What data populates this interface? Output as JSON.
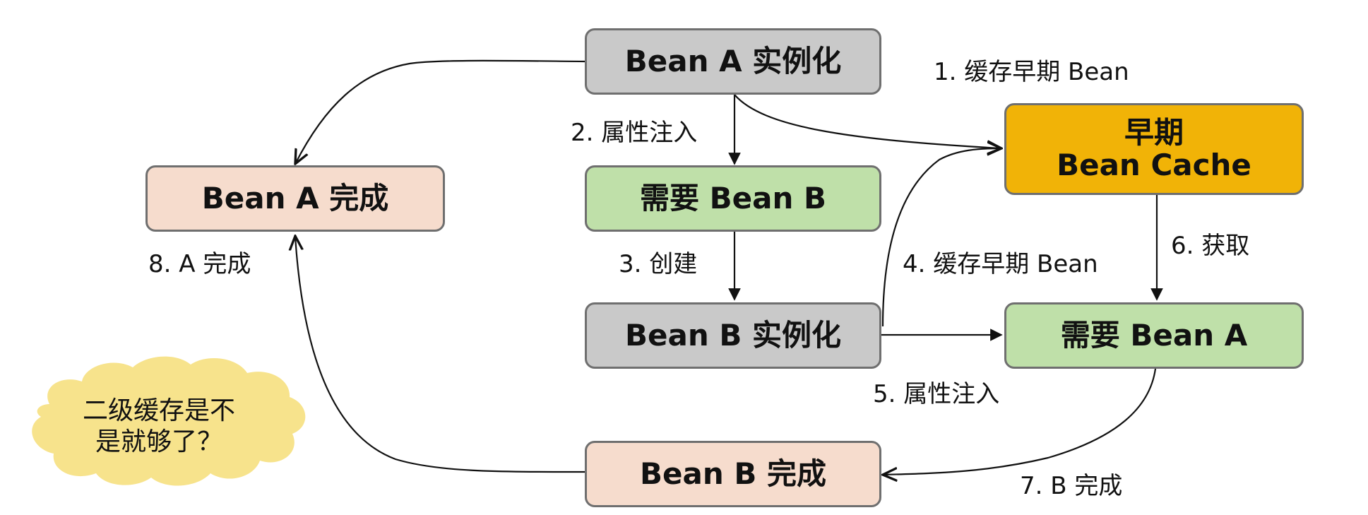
{
  "diagram": {
    "nodes": {
      "bean_a_instantiate": "Bean A 实例化",
      "bean_a_complete": "Bean A 完成",
      "need_bean_b": "需要 Bean B",
      "bean_b_instantiate": "Bean B 实例化",
      "bean_b_complete": "Bean B 完成",
      "need_bean_a": "需要 Bean A",
      "cache_line1": "早期",
      "cache_line2": "Bean Cache"
    },
    "edge_labels": {
      "step1": "1. 缓存早期 Bean",
      "step2": "2. 属性注入",
      "step3": "3. 创建",
      "step4": "4. 缓存早期 Bean",
      "step5": "5. 属性注入",
      "step6": "6. 获取",
      "step7": "7. B 完成",
      "step8": "8. A 完成"
    },
    "cloud": {
      "line1": "二级缓存是不",
      "line2": "是就够了？"
    },
    "colors": {
      "instantiate_fill": "#c9c9c9",
      "complete_fill": "#f6dccd",
      "need_fill": "#bfe0a9",
      "cache_fill": "#f1b307",
      "cloud_fill": "#f7e38c",
      "border": "#6f6f6f",
      "arrow": "#111111"
    }
  }
}
